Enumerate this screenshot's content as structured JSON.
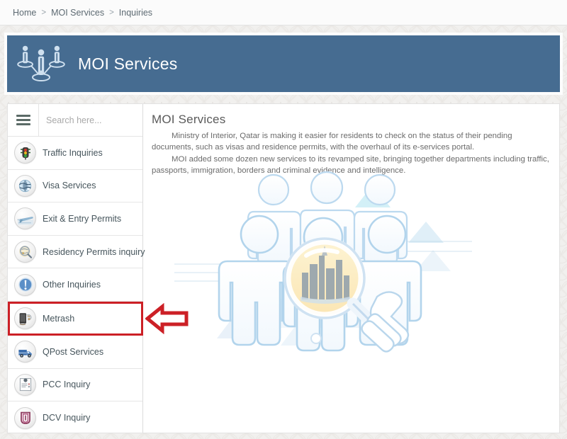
{
  "breadcrumb": {
    "name": "breadcrumb",
    "items": [
      "Home",
      "MOI Services",
      "Inquiries"
    ],
    "separator": ">"
  },
  "banner": {
    "title": "MOI Services",
    "logo_icon": "people-network-icon",
    "background_color": "#466c91",
    "text_color": "#ffffff"
  },
  "sidebar": {
    "hamburger_icon": "hamburger-menu-icon",
    "search": {
      "placeholder": "Search here...",
      "value": ""
    },
    "items": [
      {
        "label": "Traffic Inquiries",
        "icon": "traffic-light-icon"
      },
      {
        "label": "Visa Services",
        "icon": "globe-visa-icon"
      },
      {
        "label": "Exit & Entry Permits",
        "icon": "airplane-icon"
      },
      {
        "label": "Residency Permits inquiry",
        "icon": "magnifier-globe-icon"
      },
      {
        "label": "Other Inquiries",
        "icon": "exclamation-mark-icon"
      },
      {
        "label": "Metrash",
        "icon": "mobile-device-icon",
        "highlighted": true
      },
      {
        "label": "QPost Services",
        "icon": "delivery-van-icon"
      },
      {
        "label": "PCC Inquiry",
        "icon": "certificate-document-icon"
      },
      {
        "label": "DCV Inquiry",
        "icon": "document-card-icon"
      }
    ]
  },
  "content": {
    "heading": "MOI Services",
    "paragraph_1": "Ministry of Interior, Qatar is making it easier for residents to check on the status of their pending documents, such as visas and residence permits, with the overhaul of its e-services portal.",
    "paragraph_2": "MOI added some dozen new services to its revamped site, bringing together departments including traffic, passports, immigration, borders and criminal evidence and intelligence.",
    "illustration_icon": "people-magnifier-city-illustration"
  },
  "annotation": {
    "arrow_icon": "left-pointing-arrow-icon",
    "color": "#cc2026",
    "target": "Metrash"
  }
}
